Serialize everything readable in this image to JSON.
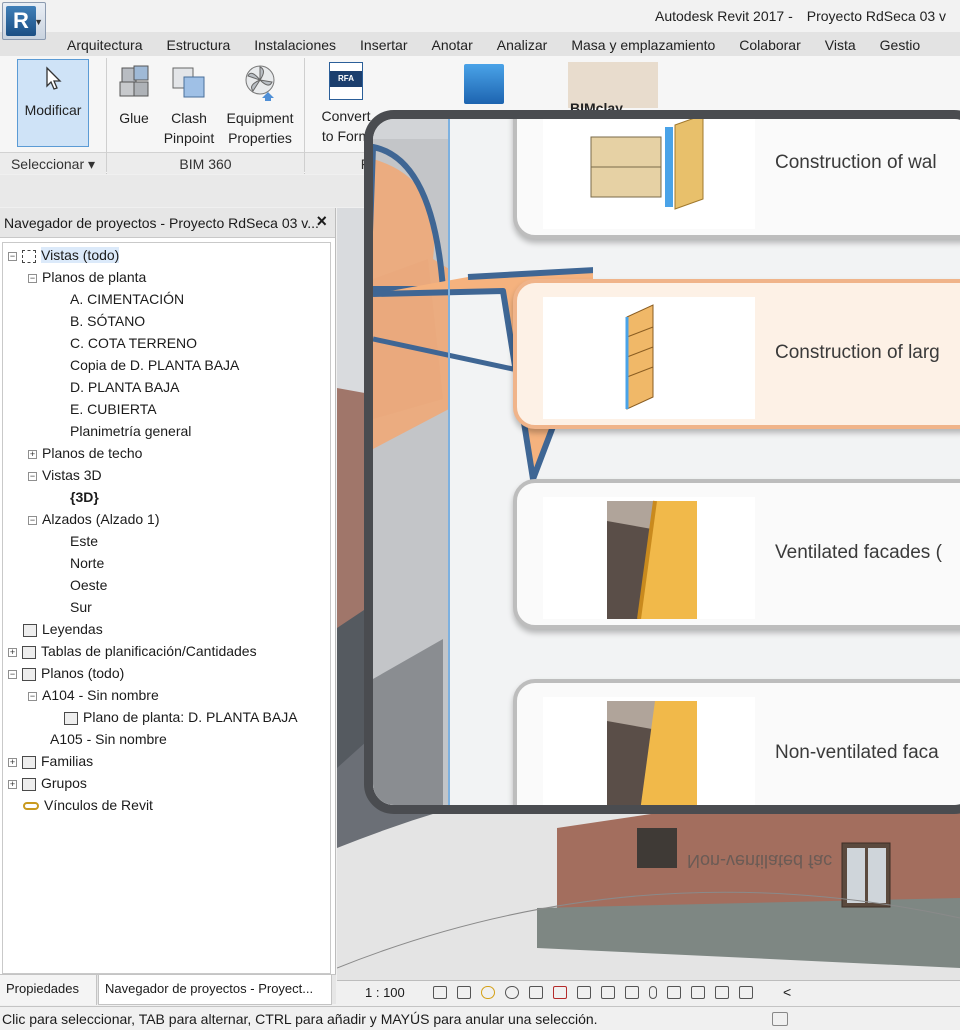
{
  "window": {
    "app_title": "Autodesk Revit 2017 -",
    "document_title": "Proyecto RdSeca 03 v"
  },
  "app_button": {
    "letter": "R"
  },
  "ribbon_tabs": [
    "Arquitectura",
    "Estructura",
    "Instalaciones",
    "Insertar",
    "Anotar",
    "Analizar",
    "Masa y emplazamiento",
    "Colaborar",
    "Vista",
    "Gestio"
  ],
  "ribbon": {
    "modify_label": "Modificar",
    "glue_label": "Glue",
    "clash_label_1": "Clash",
    "clash_label_2": "Pinpoint",
    "equip_label_1": "Equipment",
    "equip_label_2": "Properties",
    "convert_label_1": "Convert",
    "convert_label_2": "to Form",
    "rfa_label": "RFA",
    "panel_select": "Seleccionar",
    "panel_bim360": "BIM 360",
    "panel_f": "F",
    "bimclay_partial": "BIMclay"
  },
  "browser": {
    "title": "Navegador de proyectos - Proyecto RdSeca 03 v...",
    "nodes": {
      "vistas": "Vistas (todo)",
      "planos_planta": "Planos de planta",
      "cimentacion": "A. CIMENTACIÓN",
      "sotano": "B. SÓTANO",
      "cota": "C. COTA TERRENO",
      "copia": "Copia de D. PLANTA BAJA",
      "planta_baja": "D. PLANTA BAJA",
      "cubierta": "E. CUBIERTA",
      "planimetria": "Planimetría general",
      "techo": "Planos de techo",
      "vistas3d": "Vistas 3D",
      "v3d": "{3D}",
      "alzados": "Alzados (Alzado 1)",
      "este": "Este",
      "norte": "Norte",
      "oeste": "Oeste",
      "sur": "Sur",
      "leyendas": "Leyendas",
      "tablas": "Tablas de planificación/Cantidades",
      "planos": "Planos (todo)",
      "a104": "A104 - Sin nombre",
      "plano_planta": "Plano de planta: D. PLANTA BAJA",
      "a105": "A105 - Sin nombre",
      "familias": "Familias",
      "grupos": "Grupos",
      "vinculos": "Vínculos de Revit"
    }
  },
  "browser_tabs": {
    "properties": "Propiedades",
    "navigator": "Navegador de proyectos - Proyect..."
  },
  "view_bar": {
    "scale": "1 : 100",
    "collapse": "<"
  },
  "status": {
    "text": "Clic para seleccionar, TAB para alternar, CTRL para añadir y MAYÚS para anular una selección."
  },
  "overlay": {
    "cards": [
      "Construction of wal",
      "Construction of larg",
      "Ventilated facades (",
      "Non-ventilated faca"
    ],
    "mirrored_text": "Non-ventilated fac"
  }
}
